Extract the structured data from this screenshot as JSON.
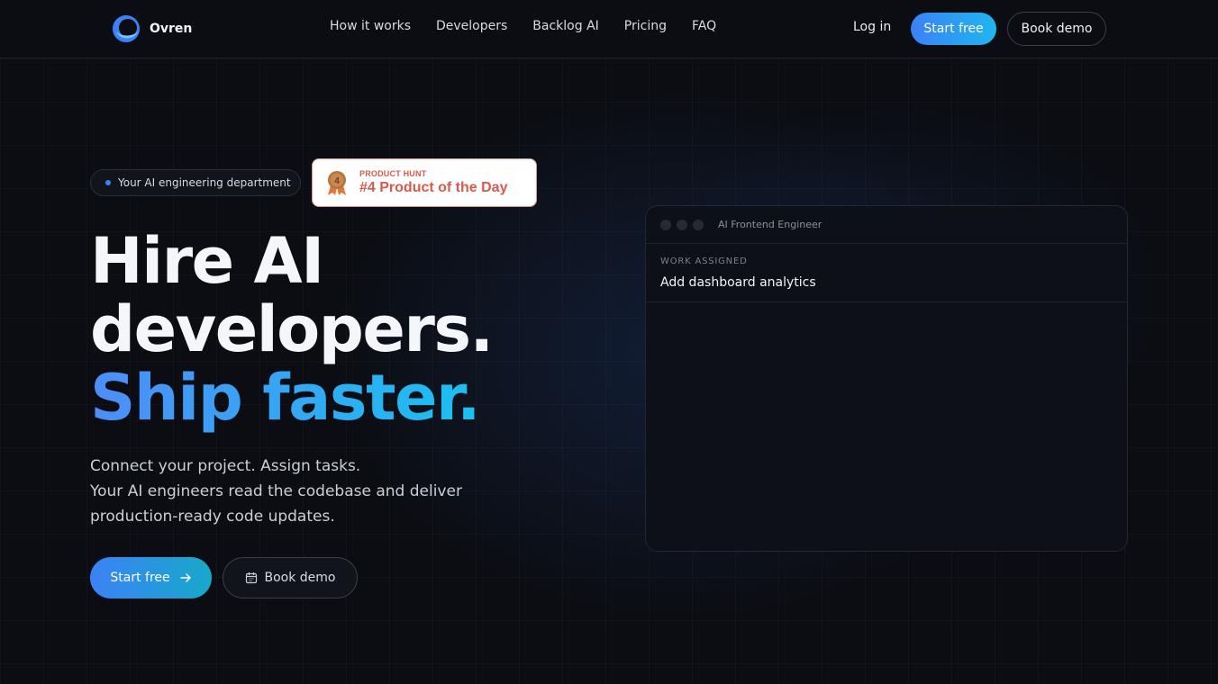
{
  "brand": {
    "name": "Ovren",
    "accent": "#3b82f6"
  },
  "nav": {
    "links": [
      "How it works",
      "Developers",
      "Backlog AI",
      "Pricing",
      "FAQ"
    ],
    "login": "Log in",
    "start_free": "Start free",
    "book_demo": "Book demo"
  },
  "hero": {
    "pill": "Your AI engineering department",
    "product_hunt": {
      "kicker": "PRODUCT HUNT",
      "title": "#4 Product of the Day",
      "rank": "4"
    },
    "headline_line1": "Hire AI",
    "headline_line2": "developers.",
    "headline_accent": "Ship faster.",
    "sub_line1": "Connect your project. Assign tasks.",
    "sub_line2": "Your AI engineers read the codebase and deliver production-ready code updates.",
    "cta_primary": "Start free",
    "cta_secondary": "Book demo"
  },
  "panel": {
    "title": "AI Frontend Engineer",
    "kicker": "WORK ASSIGNED",
    "task": "Add dashboard analytics"
  },
  "icons": [
    "ovren-logo-icon",
    "medal-icon",
    "arrow-right-icon",
    "calendar-icon"
  ]
}
